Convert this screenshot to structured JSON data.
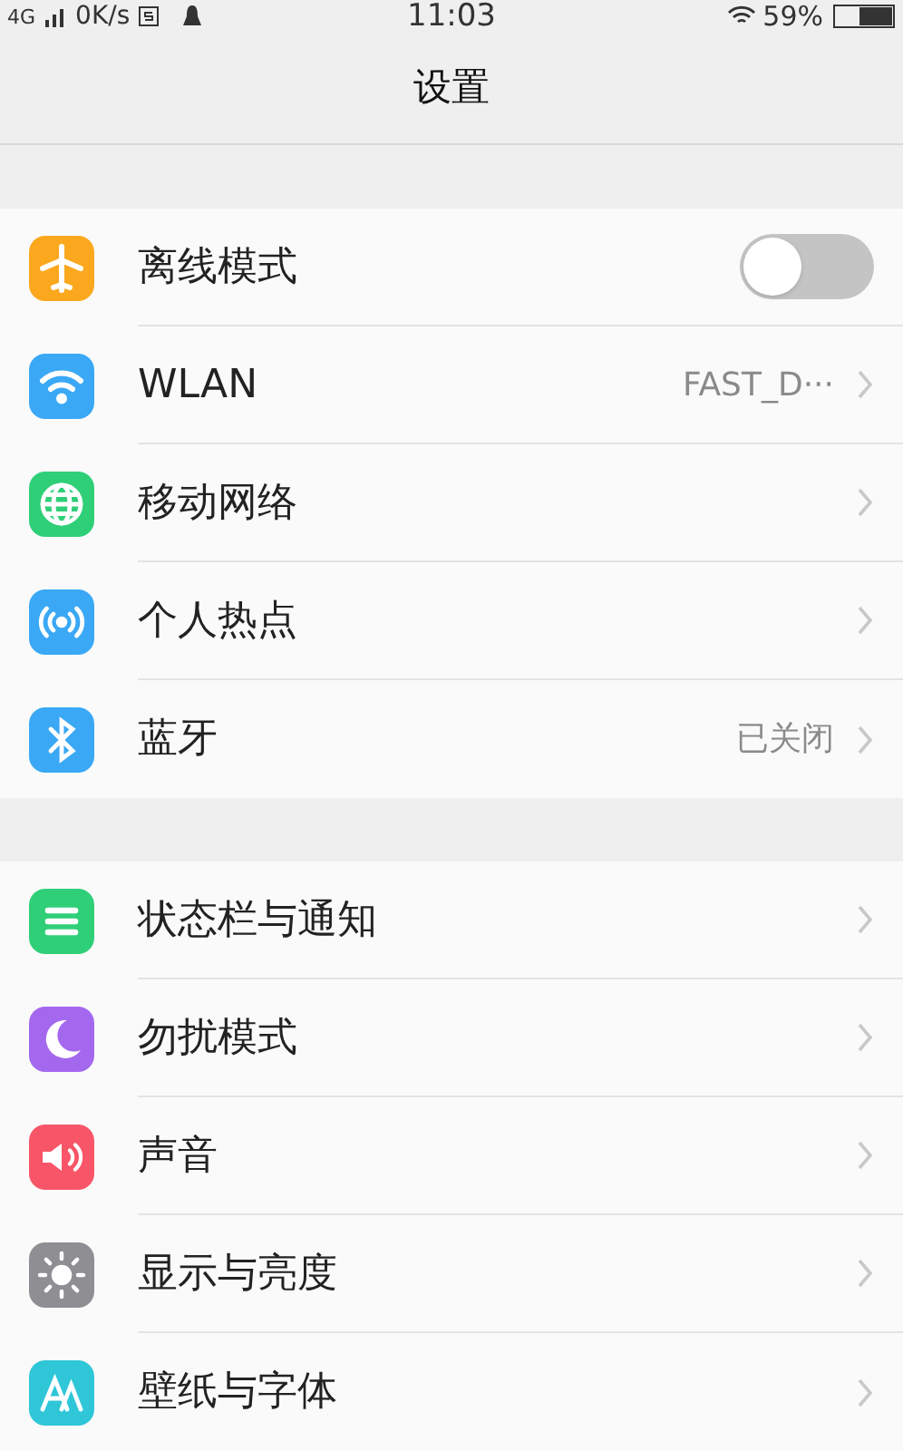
{
  "status_bar": {
    "network": "4G",
    "speed": "0K/s",
    "time": "11:03",
    "battery": "59%"
  },
  "header": {
    "title": "设置"
  },
  "sections": [
    {
      "items": [
        {
          "label": "离线模式",
          "kind": "toggle",
          "on": false,
          "color": "#fba81f"
        },
        {
          "label": "WLAN",
          "kind": "link",
          "value": "FAST_D···",
          "color": "#3aa8f5"
        },
        {
          "label": "移动网络",
          "kind": "link",
          "color": "#2fcf78"
        },
        {
          "label": "个人热点",
          "kind": "link",
          "color": "#3aa8f5"
        },
        {
          "label": "蓝牙",
          "kind": "link",
          "value": "已关闭",
          "color": "#3aa8f5"
        }
      ]
    },
    {
      "items": [
        {
          "label": "状态栏与通知",
          "kind": "link",
          "color": "#2fcf78"
        },
        {
          "label": "勿扰模式",
          "kind": "link",
          "color": "#a468ef"
        },
        {
          "label": "声音",
          "kind": "link",
          "color": "#f85668"
        },
        {
          "label": "显示与亮度",
          "kind": "link",
          "color": "#8e8e93"
        },
        {
          "label": "壁纸与字体",
          "kind": "link",
          "color": "#2fc6d8"
        }
      ]
    }
  ]
}
